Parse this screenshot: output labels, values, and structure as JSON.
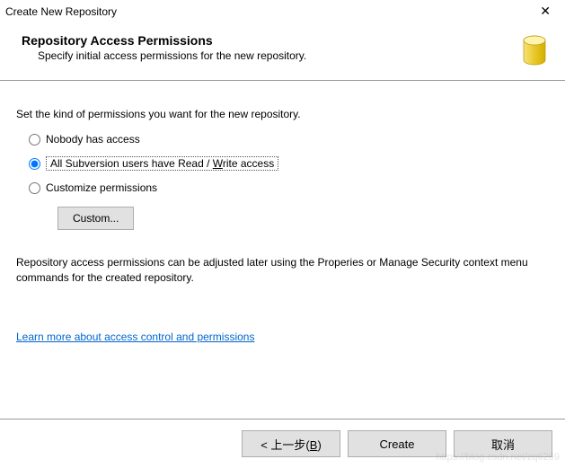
{
  "window": {
    "title": "Create New Repository"
  },
  "header": {
    "title": "Repository Access Permissions",
    "subtitle": "Specify initial access permissions for the new repository."
  },
  "content": {
    "prompt": "Set the kind of permissions you want for the new repository.",
    "options": {
      "nobody": "Nobody has access",
      "all_rw_pre": "All Subversion users have Read / ",
      "all_rw_underline": "W",
      "all_rw_post": "rite access",
      "customize": "Customize permissions"
    },
    "selected": "all_rw",
    "custom_button": "Custom...",
    "note": "Repository access permissions can be adjusted later using the Properies or Manage Security context menu commands for the created repository.",
    "link": "Learn more about access control and permissions"
  },
  "footer": {
    "back_pre": "< 上一步(",
    "back_underline": "B",
    "back_post": ")",
    "create": "Create",
    "cancel": "取消"
  },
  "watermark": "https://blog.csdn.net/zq6269"
}
